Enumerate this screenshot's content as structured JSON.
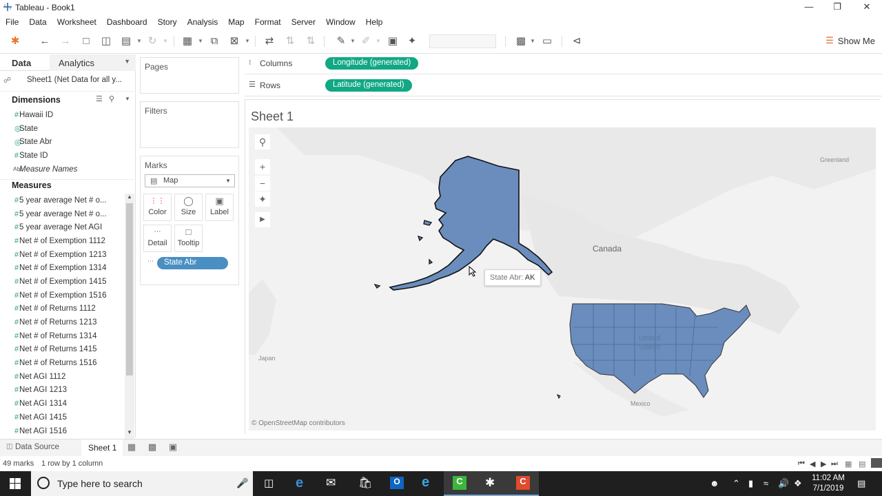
{
  "window": {
    "title": "Tableau - Book1"
  },
  "menu": [
    "File",
    "Data",
    "Worksheet",
    "Dashboard",
    "Story",
    "Analysis",
    "Map",
    "Format",
    "Server",
    "Window",
    "Help"
  ],
  "toolbar": {
    "show_me": "Show Me"
  },
  "data_pane": {
    "data_tab": "Data",
    "analytics_tab": "Analytics",
    "data_source": "Sheet1 (Net Data for all y...",
    "dimensions_title": "Dimensions",
    "dimensions": [
      {
        "label": "Hawaii ID",
        "icon": "#"
      },
      {
        "label": "State",
        "icon": "globe"
      },
      {
        "label": "State Abr",
        "icon": "globe"
      },
      {
        "label": "State ID",
        "icon": "#"
      },
      {
        "label": "Measure Names",
        "icon": "Abc"
      }
    ],
    "measures_title": "Measures",
    "measures": [
      "5 year average Net # o...",
      "5 year average Net # o...",
      "5 year average Net AGI",
      "Net # of Exemption 1112",
      "Net # of Exemption 1213",
      "Net # of Exemption 1314",
      "Net # of Exemption 1415",
      "Net # of Exemption 1516",
      "Net # of Returns 1112",
      "Net # of Returns 1213",
      "Net # of Returns 1314",
      "Net # of Returns 1415",
      "Net # of Returns 1516",
      "Net AGI 1112",
      "Net AGI 1213",
      "Net AGI 1314",
      "Net AGI 1415",
      "Net AGI 1516"
    ]
  },
  "cards": {
    "pages": "Pages",
    "filters": "Filters",
    "marks": "Marks",
    "mark_type": "Map",
    "buttons": [
      "Color",
      "Size",
      "Label",
      "Detail",
      "Tooltip"
    ],
    "marks_pill": "State Abr"
  },
  "shelves": {
    "columns_label": "Columns",
    "columns_pill": "Longitude (generated)",
    "rows_label": "Rows",
    "rows_pill": "Latitude (generated)"
  },
  "view": {
    "sheet_title": "Sheet 1",
    "tooltip_key": "State Abr:",
    "tooltip_value": "AK",
    "labels": {
      "canada": "Canada",
      "greenland": "Greenland",
      "japan": "Japan",
      "mexico": "Mexico",
      "us_faint_1": "United",
      "us_faint_2": "States"
    },
    "attribution": "© OpenStreetMap contributors",
    "state_fill": "#6a8dbd"
  },
  "tabs": {
    "data_source": "Data Source",
    "sheet": "Sheet 1"
  },
  "status": {
    "marks": "49 marks",
    "dims": "1 row by 1 column"
  },
  "taskbar": {
    "search_placeholder": "Type here to search",
    "time": "11:02 AM",
    "date": "7/1/2019"
  }
}
